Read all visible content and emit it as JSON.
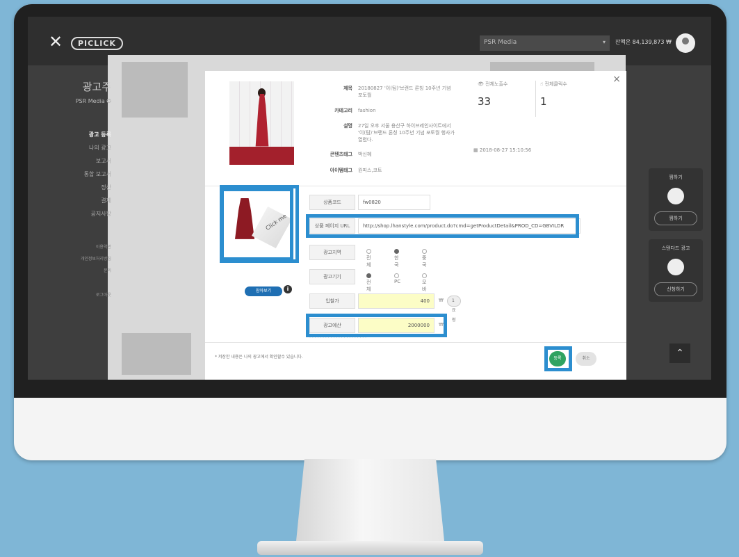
{
  "topbar": {
    "logo": "PICLICK",
    "media_select": "PSR Media",
    "balance": "잔액은 84,139,873 ₩"
  },
  "sidebar": {
    "title": "광고주",
    "subtitle": "PSR Media ✪",
    "items": [
      {
        "label": "광고 등록"
      },
      {
        "label": "나의 광고"
      },
      {
        "label": "보고서"
      },
      {
        "label": "통합 보고서"
      },
      {
        "label": "정산"
      },
      {
        "label": "결제"
      },
      {
        "label": "공지사항"
      }
    ],
    "extra": [
      "이용약관",
      "개인정보처리방침",
      "문의",
      "로그아웃"
    ]
  },
  "right_panel": {
    "label1": "찜하기",
    "btn1": "찜하기",
    "label2": "스탠다드 광고",
    "btn2": "신청하기"
  },
  "modal": {
    "close": "×",
    "title_label": "제목",
    "title_value": "20180827 '이(팀)'브랜드 론칭 10주년 기념 포토월",
    "category_label": "카테고리",
    "category_value": "fashion",
    "desc_label": "설명",
    "desc_value": "27일 오후 서울 용산구 하이브레인사이트에서 '이(팀)'브랜드 론칭 10주년 기념 포토월 행사가 열렸다.",
    "content_tag_label": "콘텐츠태그",
    "content_tag_value": "박신혜",
    "item_tag_label": "아이템태그",
    "item_tag_value": "원피스,코트",
    "impressions_label": "전체노출수",
    "impressions_value": "33",
    "clicks_label": "전체클릭수",
    "clicks_value": "1",
    "date": "2018-08-27 15:10:56",
    "product_code_label": "상품코드",
    "product_code_value": "fw0820",
    "product_url_label": "상품 페이지 URL",
    "product_url_value": "http://shop.lhanstyle.com/product.do?cmd=getProductDetail&PROD_CD=GBVILDR",
    "region_label": "광고지역",
    "region_options": [
      "전체",
      "한국",
      "중국"
    ],
    "device_label": "광고기기",
    "device_options": [
      "전체",
      "PC",
      "모바일"
    ],
    "bid_label": "입찰가",
    "bid_value": "400",
    "bid_unit": "₩",
    "bid_pill": "1요청",
    "budget_label": "광고예산",
    "budget_value": "2000000",
    "budget_unit": "₩",
    "preview_btn": "참아보기",
    "sticker_text": "Click me",
    "footer_note": "* 저장한 내용은 나의 광고에서 확인할수 있습니다.",
    "register_btn": "등록",
    "cancel_btn": "취소"
  },
  "colors": {
    "highlight": "#2c8ecf",
    "register": "#2fa361",
    "budget_field": "#fcfdc6"
  }
}
